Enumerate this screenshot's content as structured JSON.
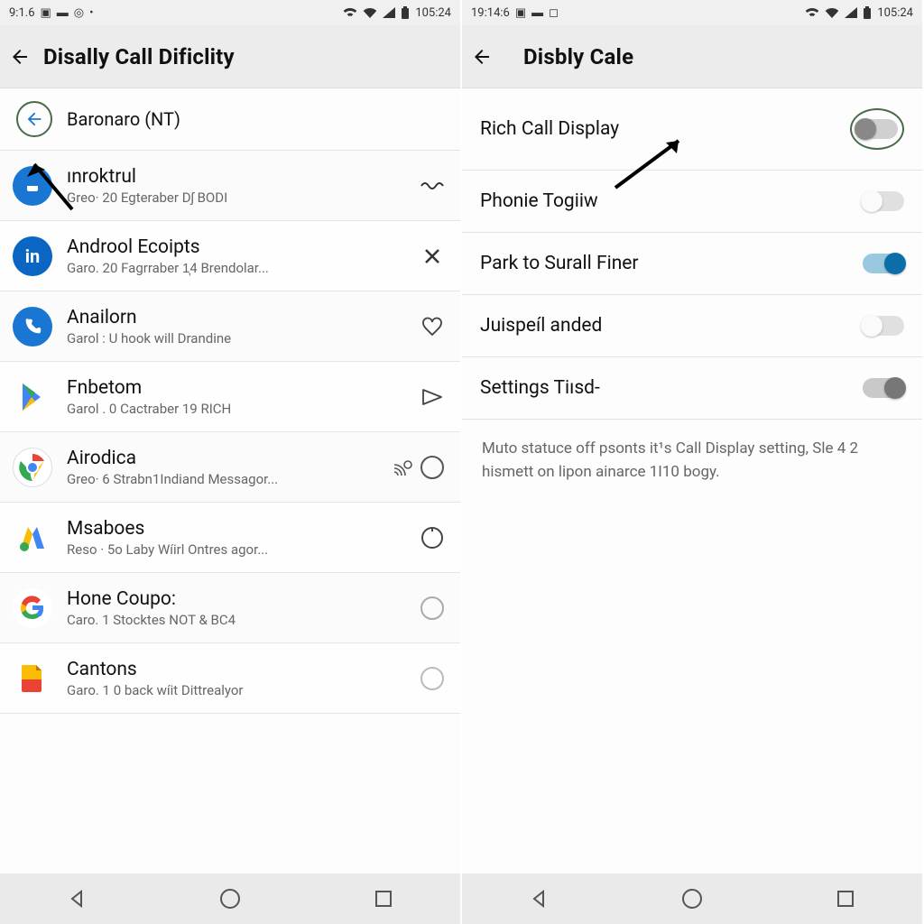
{
  "left": {
    "status": {
      "time_left": "9:1.6",
      "time_right": "105:24"
    },
    "title": "Disally Call Dificlity",
    "first_row_label": "Baronaro (NT)",
    "items": [
      {
        "icon": "blue-square",
        "title": "ınroktrul",
        "sub": "Greo· 20 Egteraber Dʃ BODI",
        "action": "wave"
      },
      {
        "icon": "linkedin",
        "title": "Androol Ecoipts",
        "sub": "Garo. 20 Fagrraber 1̦4 Brendolar...",
        "action": "close"
      },
      {
        "icon": "phone",
        "title": "Anailorn",
        "sub": "Garol : U hook will Drandine",
        "action": "heart"
      },
      {
        "icon": "play",
        "title": "Fnbetom",
        "sub": "Garol . 0 Cactraber 19 RICH",
        "action": "play"
      },
      {
        "icon": "chrome",
        "title": "Airodica",
        "sub": "Greo· 6 Strabn1Indiand Messagor...",
        "action": "cast-ring"
      },
      {
        "icon": "ads",
        "title": "Msaboes",
        "sub": "Reso · 5o Laby Wíirl Ontres agor...",
        "action": "ring"
      },
      {
        "icon": "google",
        "title": "Hone Coupo:",
        "sub": "Caro. 1 Stocktes NOT & BC4",
        "action": "ring-light"
      },
      {
        "icon": "sheets",
        "title": "Cantons",
        "sub": "Garo. 1 0 back wíit Dittrealyor",
        "action": "ring-light"
      }
    ]
  },
  "right": {
    "status": {
      "time_left": "19:14:6",
      "time_right": "105:24"
    },
    "title": "Disbly Cale",
    "settings": [
      {
        "label": "Rich Call Display",
        "state": "off-circled"
      },
      {
        "label": "Phonie Togiiw",
        "state": "off-light"
      },
      {
        "label": "Park to Surall Finer",
        "state": "on"
      },
      {
        "label": "Juispeíl anded",
        "state": "off-light"
      },
      {
        "label": "Settings Tiısd-",
        "state": "on-grey"
      }
    ],
    "description": "Muto statuce off psonts it¹s Call Display setting, Sle 4 2 hismett on lipon ainarce 1I10 bogy."
  },
  "glyphs": {
    "wifi": "📶",
    "batt": "🔋",
    "signal": "◢"
  }
}
